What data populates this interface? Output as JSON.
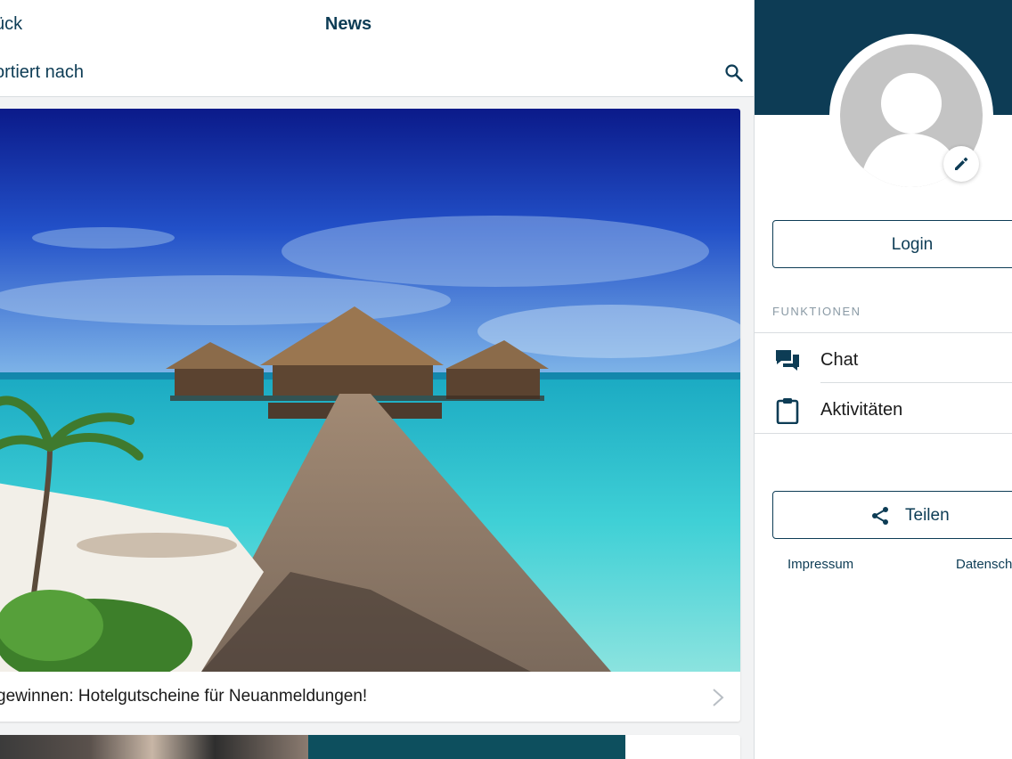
{
  "header": {
    "back_label": "ück",
    "title": "News",
    "sort_label": "ortiert nach"
  },
  "news": [
    {
      "title": "gewinnen: Hotelgutscheine für Neuanmeldungen!"
    }
  ],
  "sidebar": {
    "login_label": "Login",
    "section_label": "FUNKTIONEN",
    "menu": [
      {
        "label": "Chat",
        "icon": "chat-icon"
      },
      {
        "label": "Aktivitäten",
        "icon": "clipboard-icon"
      }
    ],
    "share_label": "Teilen",
    "footer_links": [
      "Impressum",
      "Datensch"
    ]
  },
  "colors": {
    "brand": "#0d3c55",
    "background": "#f2f3f4"
  }
}
